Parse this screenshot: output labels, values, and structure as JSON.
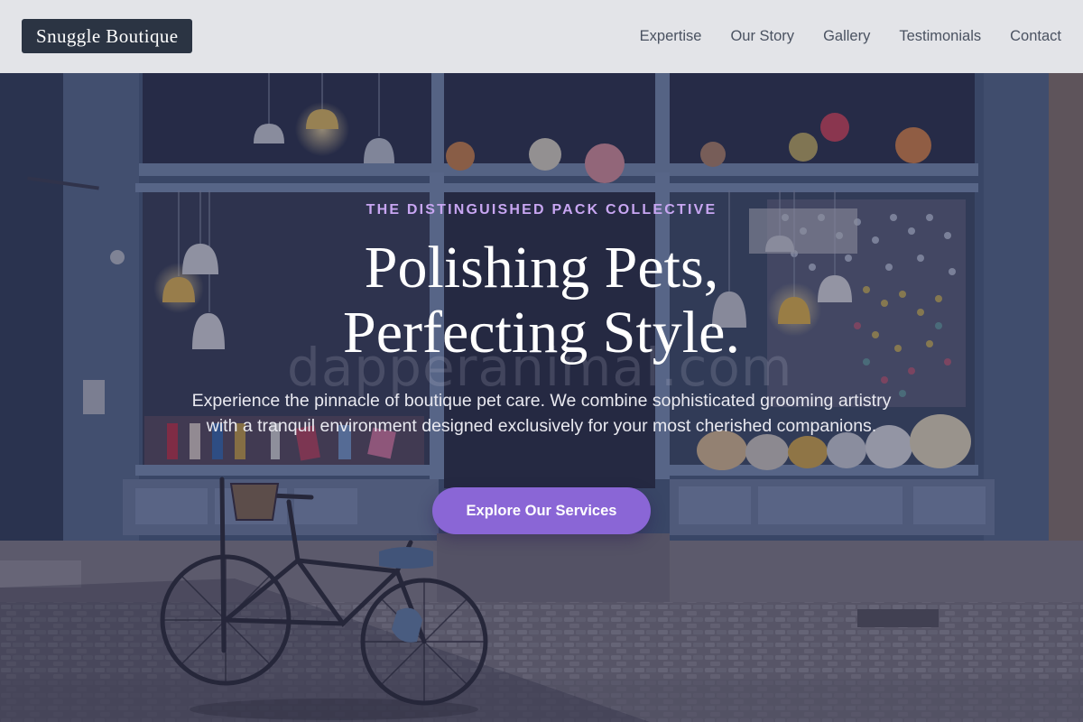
{
  "brand": {
    "name": "Snuggle Boutique"
  },
  "nav": {
    "items": [
      {
        "label": "Expertise"
      },
      {
        "label": "Our Story"
      },
      {
        "label": "Gallery"
      },
      {
        "label": "Testimonials"
      },
      {
        "label": "Contact"
      }
    ]
  },
  "hero": {
    "eyebrow": "THE DISTINGUISHED PACK COLLECTIVE",
    "headline_line1": "Polishing Pets,",
    "headline_line2": "Perfecting Style.",
    "lead": "Experience the pinnacle of boutique pet care. We combine sophisticated grooming artistry with a tranquil environment designed exclusively for your most cherished companions.",
    "cta_label": "Explore Our Services",
    "background_sign_text": "dapperanimal.com"
  },
  "colors": {
    "header_bg": "#e3e4e8",
    "logo_bg": "#2b3443",
    "accent_purple": "#8a66d6",
    "eyebrow_lavender": "#c8a6f2"
  }
}
